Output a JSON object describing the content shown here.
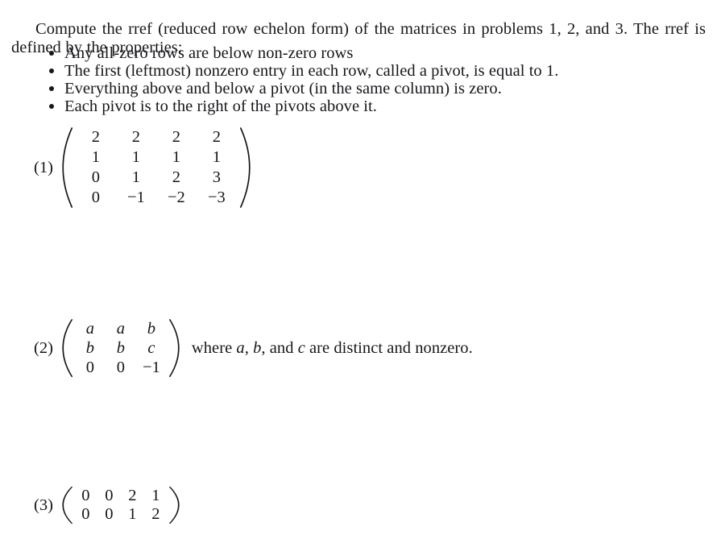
{
  "document": {
    "intro": "Compute the rref (reduced row echelon form) of the matrices in problems 1, 2, and 3. The rref is defined by the properties:",
    "properties": [
      "Any all-zero rows are below non-zero rows",
      "The first (leftmost) nonzero entry in each row, called a pivot, is equal to 1.",
      "Everything above and below a pivot (in the same column) is zero.",
      "Each pivot is to the right of the pivots above it."
    ],
    "problems": [
      {
        "label": "(1)",
        "rows": 4,
        "cols": 4,
        "matrix": [
          [
            "2",
            "2",
            "2",
            "2"
          ],
          [
            "1",
            "1",
            "1",
            "1"
          ],
          [
            "0",
            "1",
            "2",
            "3"
          ],
          [
            "0",
            "−1",
            "−2",
            "−3"
          ]
        ],
        "note": ""
      },
      {
        "label": "(2)",
        "rows": 3,
        "cols": 3,
        "matrix": [
          [
            "a",
            "a",
            "b"
          ],
          [
            "b",
            "b",
            "c"
          ],
          [
            "0",
            "0",
            "−1"
          ]
        ],
        "italic_entries": [
          "a",
          "b",
          "c"
        ],
        "note_prefix": "where ",
        "note_a": "a",
        "note_sep1": ", ",
        "note_b": "b",
        "note_sep2": ", and ",
        "note_c": "c",
        "note_suffix": " are distinct and nonzero."
      },
      {
        "label": "(3)",
        "rows": 2,
        "cols": 4,
        "matrix": [
          [
            "0",
            "0",
            "2",
            "1"
          ],
          [
            "0",
            "0",
            "1",
            "2"
          ]
        ],
        "note": ""
      }
    ]
  },
  "style": {
    "text_color": "#17171c",
    "background_color": "#ffffff"
  }
}
